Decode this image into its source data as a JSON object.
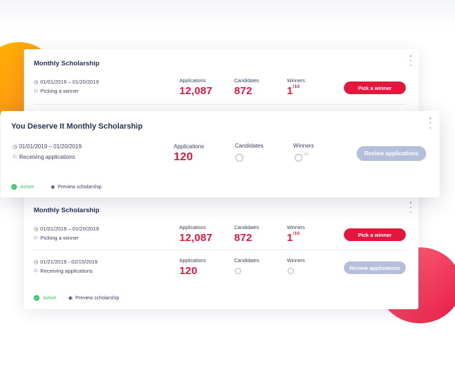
{
  "colors": {
    "accent_red": "#e3173e",
    "disabled_button": "#b4bfdc",
    "active_green": "#39c26a",
    "title_navy": "#27305a",
    "orange_blob": "#ffb400",
    "red_blob": "#e51a45"
  },
  "icons": {
    "calendar": "clock-icon",
    "status": "flag-icon",
    "active": "check-circle-icon",
    "preview": "eye-icon",
    "menu": "kebab-menu-icon"
  },
  "back_card": {
    "title_top": "Monthly Scholarship",
    "title_bottom": "Monthly Scholarship",
    "row1": {
      "dates": "01/01/2019 – 01/20/2019",
      "status": "Picking a winner",
      "applications_label": "Applications",
      "applications_value": "12,087",
      "candidates_label": "Candidates",
      "candidates_value": "872",
      "winners_label": "Winners",
      "winners_value": "1",
      "winners_total": "/10",
      "button": "Pick a winner"
    },
    "row2": {
      "dates": "01/01/2019 – 01/20/2019",
      "status": "Picking a winner",
      "applications_label": "Applications",
      "applications_value": "12,087",
      "candidates_label": "Candidates",
      "candidates_value": "872",
      "winners_label": "Winners",
      "winners_value": "1",
      "winners_total": "/10",
      "button": "Pick a winner"
    },
    "row3": {
      "dates": "01/21/2019 - 02/15/2019",
      "status": "Receiving applications",
      "applications_label": "Applications",
      "applications_value": "120",
      "candidates_label": "Candidates",
      "winners_label": "Winners",
      "button": "Review applications"
    },
    "footer": {
      "active": "Active",
      "preview": "Preview scholarship"
    }
  },
  "front_card": {
    "title": "You Deserve It Monthly Scholarship",
    "dates": "01/01/2019 – 01/20/2019",
    "status": "Receiving applications",
    "applications_label": "Applications",
    "applications_value": "120",
    "candidates_label": "Candidates",
    "winners_label": "Winners",
    "winners_total": "/10",
    "button": "Review applications",
    "footer": {
      "active": "Active",
      "preview": "Preview scholarship"
    }
  }
}
